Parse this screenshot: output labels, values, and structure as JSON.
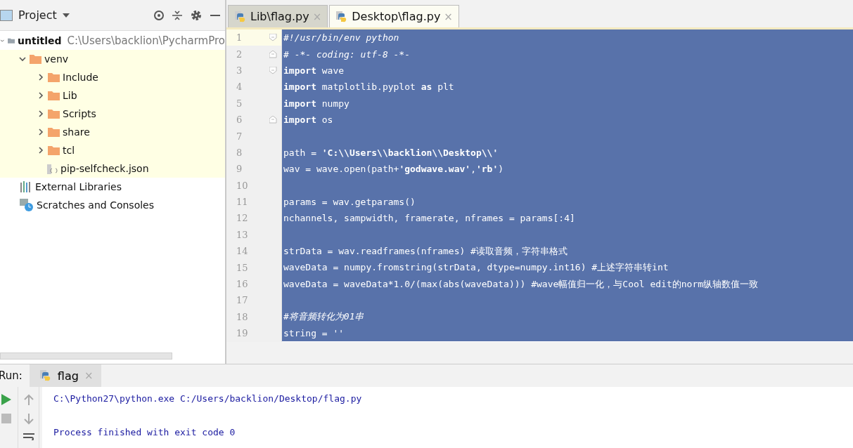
{
  "project_panel": {
    "title": "Project",
    "tree": [
      {
        "kind": "root",
        "label": "untitled",
        "path": "C:\\Users\\backlion\\PycharmPro",
        "expanded": true,
        "children": [
          {
            "kind": "folder",
            "label": "venv",
            "expanded": true,
            "excluded": true,
            "children": [
              {
                "kind": "folder",
                "label": "Include",
                "expanded": false
              },
              {
                "kind": "folder",
                "label": "Lib",
                "expanded": false
              },
              {
                "kind": "folder",
                "label": "Scripts",
                "expanded": false
              },
              {
                "kind": "folder",
                "label": "share",
                "expanded": false
              },
              {
                "kind": "folder",
                "label": "tcl",
                "expanded": false
              },
              {
                "kind": "file",
                "label": "pip-selfcheck.json"
              }
            ]
          }
        ]
      },
      {
        "kind": "library",
        "label": "External Libraries"
      },
      {
        "kind": "scratches",
        "label": "Scratches and Consoles"
      }
    ]
  },
  "editor_tabs": [
    {
      "label": "Lib\\flag.py",
      "close": "×",
      "selected": false
    },
    {
      "label": "Desktop\\flag.py",
      "close": "×",
      "selected": true
    }
  ],
  "code_lines": [
    {
      "number": "1",
      "text": "#!/usr/bin/env python",
      "kind": "comment",
      "fold_open": true,
      "selected": true
    },
    {
      "number": "2",
      "text": "# -*- coding: utf-8 -*-",
      "kind": "comment",
      "fold_close": true,
      "selected": true
    },
    {
      "number": "3",
      "text": "**import** wave",
      "kind": "code",
      "fold_open": true,
      "selected": true
    },
    {
      "number": "4",
      "text": "**import** matplotlib.pyplot **as** plt",
      "kind": "code",
      "selected": true
    },
    {
      "number": "5",
      "text": "**import** numpy",
      "kind": "code",
      "selected": true
    },
    {
      "number": "6",
      "text": "**import** os",
      "kind": "code",
      "fold_close": true,
      "selected": true
    },
    {
      "number": "7",
      "kind": "blank",
      "selected": true
    },
    {
      "number": "8",
      "text": "path = **'C:\\\\Users\\\\backlion\\\\Desktop\\\\'**",
      "kind": "code",
      "selected": true
    },
    {
      "number": "9",
      "text": "wav = wave.open(path+**'godwave.wav'**,**'rb'**)",
      "kind": "code",
      "selected": true
    },
    {
      "number": "10",
      "kind": "blank",
      "selected": true
    },
    {
      "number": "11",
      "text": "params = wav.getparams()",
      "kind": "code",
      "selected": true
    },
    {
      "number": "12",
      "text": "nchannels, sampwidth, framerate, nframes = params[:4]",
      "kind": "code",
      "selected": true
    },
    {
      "number": "13",
      "kind": "blank",
      "selected": true
    },
    {
      "number": "14",
      "text": "strData = wav.readframes(nframes) #读取音频，字符串格式",
      "kind": "code",
      "selected": true
    },
    {
      "number": "15",
      "text": "waveData = numpy.fromstring(strData, dtype=numpy.int16) #上述字符串转int",
      "kind": "code",
      "selected": true
    },
    {
      "number": "16",
      "text": "waveData = waveData*1.0/(max(abs(waveData))) #wave幅值归一化，与Cool edit的norm纵轴数值一致",
      "kind": "plain",
      "selected": true
    },
    {
      "number": "17",
      "kind": "blank",
      "selected": true
    },
    {
      "number": "18",
      "text": "#将音频转化为01串",
      "kind": "comment",
      "selected": true
    },
    {
      "number": "19",
      "text": "string = ''",
      "kind": "code",
      "selected": true
    }
  ],
  "run_panel": {
    "label": "Run:",
    "tabs": [
      {
        "label": "flag",
        "close": "×",
        "selected": true
      }
    ],
    "console": [
      "C:\\Python27\\python.exe C:/Users/backlion/Desktop/flag.py",
      "Process finished with exit code 0"
    ]
  }
}
